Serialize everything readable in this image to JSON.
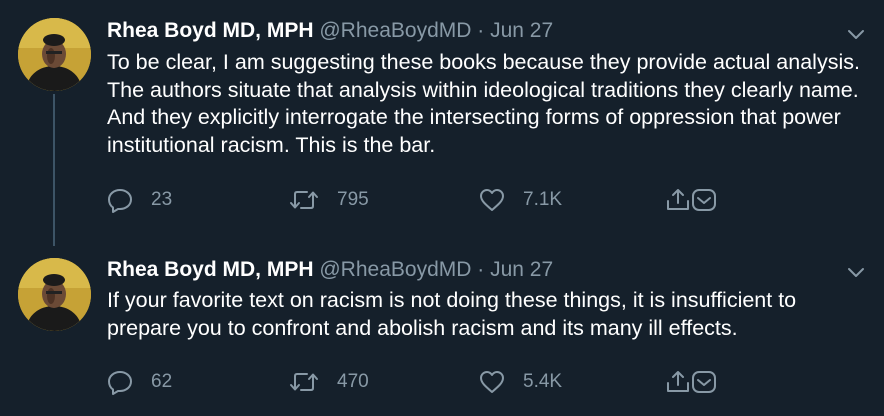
{
  "tweets": [
    {
      "author_name": "Rhea Boyd MD, MPH",
      "handle": "@RheaBoydMD",
      "separator": "·",
      "date": "Jun 27",
      "text": "To be clear, I am suggesting these books because they provide actual analysis. The authors situate that analysis within ideological traditions they clearly name. And they explicitly interrogate the intersecting forms of oppression that power institutional racism. This is the bar.",
      "replies": "23",
      "retweets": "795",
      "likes": "7.1K"
    },
    {
      "author_name": "Rhea Boyd MD, MPH",
      "handle": "@RheaBoydMD",
      "separator": "·",
      "date": "Jun 27",
      "text": "If your favorite text on racism is not doing these things, it is insufficient to prepare you to confront and abolish racism and its many ill effects.",
      "replies": "62",
      "retweets": "470",
      "likes": "5.4K"
    }
  ],
  "icons": [
    "avatar",
    "chevron-down-icon",
    "reply-icon",
    "retweet-icon",
    "like-icon",
    "share-icon",
    "dm-icon"
  ],
  "colors": {
    "background": "#15202b",
    "text": "#ffffff",
    "muted": "#8899a6",
    "thread_line": "#3d5466"
  }
}
